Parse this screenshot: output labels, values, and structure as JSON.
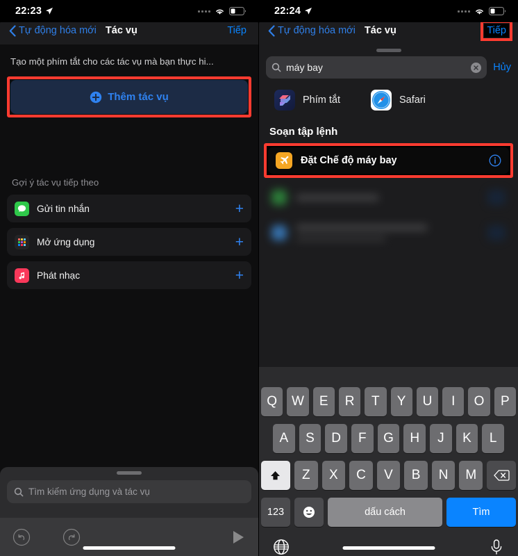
{
  "colors": {
    "highlight": "#ff3b30",
    "accent_blue": "#0a84ff",
    "link_blue": "#2f82f0",
    "panel_bg": "#1c1c1e",
    "screen_bg": "#000000",
    "keyboard_bg": "#2c2c2e",
    "key_bg": "#6d6d70"
  },
  "left": {
    "statusbar": {
      "time": "22:23",
      "location_icon": "location-arrow-icon",
      "cellular_icon": "signal-dots-icon",
      "wifi_icon": "wifi-icon",
      "battery_icon": "battery-icon"
    },
    "nav": {
      "back_label": "Tự động hóa mới",
      "back_icon": "chevron-left-icon",
      "title": "Tác vụ",
      "next_label": "Tiếp"
    },
    "description": "Tạo một phím tắt cho các tác vụ mà bạn thực hi...",
    "add_action": {
      "label": "Thêm tác vụ",
      "icon": "plus-circle-icon",
      "highlighted": true
    },
    "suggestions_title": "Gợi ý tác vụ tiếp theo",
    "suggestions": [
      {
        "label": "Gửi tin nhắn",
        "icon": "messages-icon",
        "icon_color": "#2fc84a",
        "add_icon": "plus-icon"
      },
      {
        "label": "Mở ứng dụng",
        "icon": "app-grid-icon",
        "icon_color": "#2b2b2d",
        "add_icon": "plus-icon"
      },
      {
        "label": "Phát nhạc",
        "icon": "music-icon",
        "icon_color": "#f9385a",
        "add_icon": "plus-icon"
      }
    ],
    "drawer": {
      "search_placeholder": "Tìm kiếm ứng dụng và tác vụ",
      "search_icon": "search-icon",
      "grabber": "drag-grabber"
    },
    "toolbar": {
      "undo_icon": "undo-icon",
      "redo_icon": "redo-icon",
      "play_icon": "play-icon"
    }
  },
  "right": {
    "statusbar": {
      "time": "22:24",
      "location_icon": "location-arrow-icon",
      "cellular_icon": "signal-dots-icon",
      "wifi_icon": "wifi-icon",
      "battery_icon": "battery-icon"
    },
    "nav": {
      "back_label": "Tự động hóa mới",
      "back_icon": "chevron-left-icon",
      "title": "Tác vụ",
      "next_label": "Tiếp",
      "next_highlighted": true
    },
    "search": {
      "value": "máy bay",
      "search_icon": "search-icon",
      "clear_icon": "clear-circle-icon",
      "cancel_label": "Hủy"
    },
    "apps": [
      {
        "name": "Phím tắt",
        "icon": "shortcuts-app-icon"
      },
      {
        "name": "Safari",
        "icon": "safari-app-icon"
      }
    ],
    "section_title": "Soạn tập lệnh",
    "result": {
      "label": "Đặt Chế độ máy bay",
      "icon": "airplane-icon",
      "icon_color": "#f5a623",
      "info_icon": "info-circle-icon",
      "highlighted": true
    },
    "blurred_results": [
      {
        "icon_color": "#2f8f3e"
      },
      {
        "icon_color": "#3a7fc4"
      }
    ],
    "keyboard": {
      "row1": [
        "Q",
        "W",
        "E",
        "R",
        "T",
        "Y",
        "U",
        "I",
        "O",
        "P"
      ],
      "row2": [
        "A",
        "S",
        "D",
        "F",
        "G",
        "H",
        "J",
        "K",
        "L"
      ],
      "row3": [
        "Z",
        "X",
        "C",
        "V",
        "B",
        "N",
        "M"
      ],
      "shift_icon": "shift-arrow-icon",
      "backspace_icon": "backspace-icon",
      "numbers_label": "123",
      "emoji_icon": "emoji-smiley-icon",
      "space_label": "dấu cách",
      "search_label": "Tìm",
      "globe_icon": "globe-icon",
      "mic_icon": "microphone-icon"
    }
  }
}
